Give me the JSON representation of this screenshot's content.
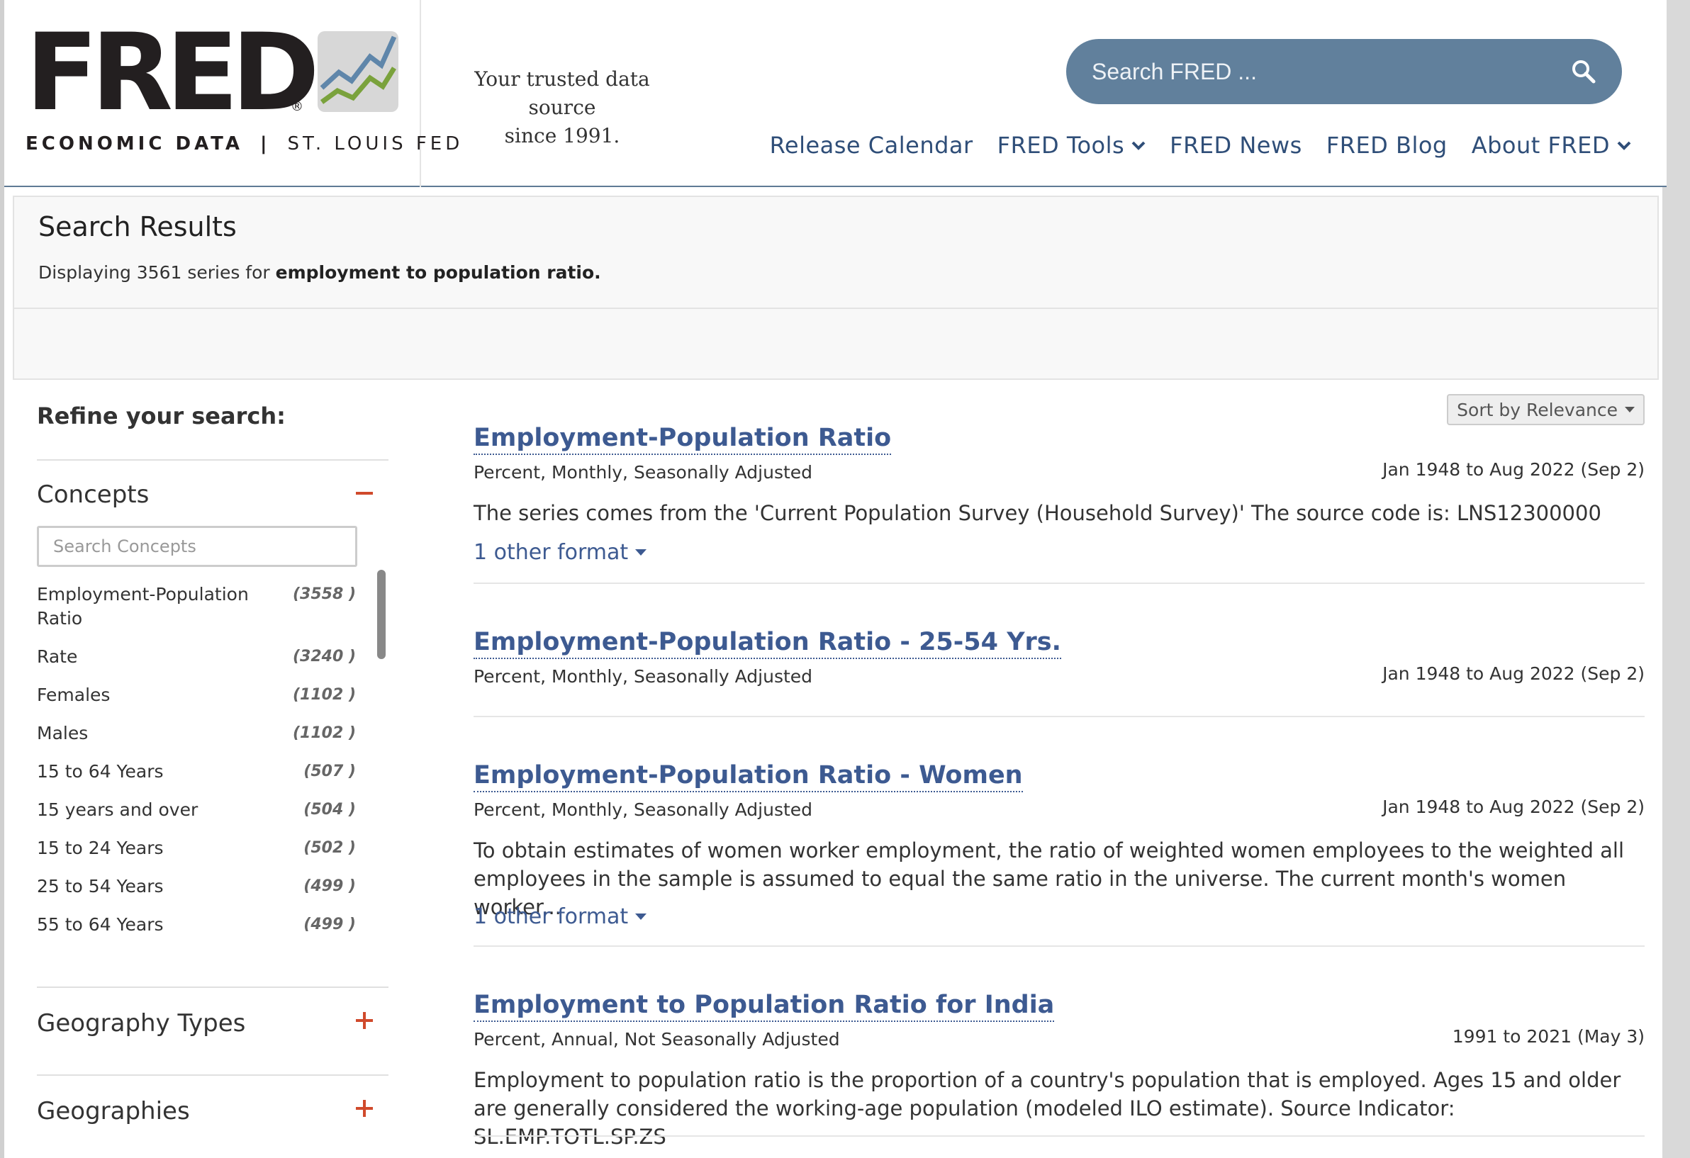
{
  "header": {
    "logo_word": "FRED",
    "logo_reg": "®",
    "logo_econ": "ECONOMIC DATA",
    "logo_sep": "|",
    "logo_fed": "ST. LOUIS FED",
    "tagline_line1": "Your trusted data source",
    "tagline_line2": "since 1991.",
    "search_placeholder": "Search FRED ...",
    "nav": [
      {
        "label": "Release Calendar"
      },
      {
        "label": "FRED Tools"
      },
      {
        "label": "FRED News"
      },
      {
        "label": "FRED Blog"
      },
      {
        "label": "About FRED"
      }
    ]
  },
  "results": {
    "title": "Search Results",
    "desc_prefix": "Displaying 3561 series for ",
    "query": "employment to population ratio."
  },
  "sidebar": {
    "refine_label": "Refine your search:",
    "concepts_title": "Concepts",
    "concepts_search_placeholder": "Search Concepts",
    "concepts": [
      {
        "label": "Employment-Population Ratio",
        "count": "(3558 )"
      },
      {
        "label": "Rate",
        "count": "(3240 )"
      },
      {
        "label": "Females",
        "count": "(1102 )"
      },
      {
        "label": "Males",
        "count": "(1102 )"
      },
      {
        "label": "15 to 64 Years",
        "count": "(507 )"
      },
      {
        "label": "15 years and over",
        "count": "(504 )"
      },
      {
        "label": "15 to 24 Years",
        "count": "(502 )"
      },
      {
        "label": "25 to 54 Years",
        "count": "(499 )"
      },
      {
        "label": "55 to 64 Years",
        "count": "(499 )"
      }
    ],
    "geography_types_title": "Geography Types",
    "geographies_title": "Geographies"
  },
  "main": {
    "sort_label": "Sort by Relevance",
    "items": [
      {
        "title": "Employment-Population Ratio",
        "meta": "Percent, Monthly, Seasonally Adjusted",
        "date": "Jan 1948 to Aug 2022 (Sep 2)",
        "desc": "The series comes from the 'Current Population Survey (Household Survey)' The source code is: LNS12300000",
        "format": "1 other format"
      },
      {
        "title": "Employment-Population Ratio - 25-54 Yrs.",
        "meta": "Percent, Monthly, Seasonally Adjusted",
        "date": "Jan 1948 to Aug 2022 (Sep 2)",
        "desc": "",
        "format": ""
      },
      {
        "title": "Employment-Population Ratio - Women",
        "meta": "Percent, Monthly, Seasonally Adjusted",
        "date": "Jan 1948 to Aug 2022 (Sep 2)",
        "desc": "To obtain estimates of women worker employment, the ratio of weighted women employees to the weighted all employees in the sample is assumed to equal the same ratio in the universe. The current month's women worker...",
        "format": "1 other format"
      },
      {
        "title": "Employment to Population Ratio for India",
        "meta": "Percent, Annual, Not Seasonally Adjusted",
        "date": "1991 to 2021 (May 3)",
        "desc": "Employment to population ratio is the proportion of a country's population that is employed. Ages 15 and older are generally considered the working-age population (modeled ILO estimate). Source Indicator: SL.EMP.TOTL.SP.ZS",
        "format": ""
      }
    ]
  }
}
